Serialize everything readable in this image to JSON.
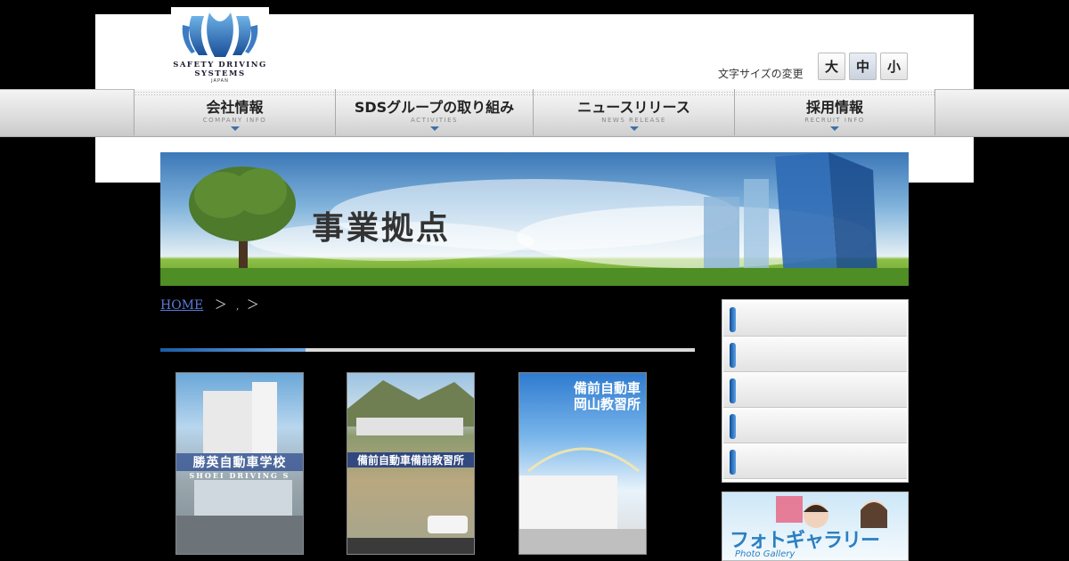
{
  "logo": {
    "line1": "SAFETY DRIVING",
    "line2": "SYSTEMS",
    "line3": "JAPAN"
  },
  "font_size": {
    "label": "文字サイズの変更",
    "large": "大",
    "medium": "中",
    "small": "小",
    "selected": "中"
  },
  "nav": [
    {
      "label": "会社情報",
      "sub": "COMPANY INFO"
    },
    {
      "label": "SDSグループの取り組み",
      "sub": "ACTIVITIES"
    },
    {
      "label": "ニュースリリース",
      "sub": "NEWS RELEASE"
    },
    {
      "label": "採用情報",
      "sub": "RECRUIT INFO"
    }
  ],
  "banner": {
    "title": "事業拠点"
  },
  "breadcrumb": {
    "home": "HOME",
    "sep1": "＞",
    "dot": ",",
    "sep2": "＞"
  },
  "schools": [
    {
      "name": "勝英自動車学校",
      "sub": "SHOEI DRIVING S"
    },
    {
      "name": "備前自動車備前教習所",
      "sub": ""
    },
    {
      "name_line1": "備前自動車",
      "name_line2": "岡山教習所"
    }
  ],
  "sidebar": {
    "item_count": 5
  },
  "gallery": {
    "title": "フォトギャラリー",
    "subtitle": "Photo Gallery"
  },
  "colors": {
    "accent": "#1c5ca8",
    "link": "#5b7bd8",
    "nav_arrow": "#3f6fa8"
  }
}
